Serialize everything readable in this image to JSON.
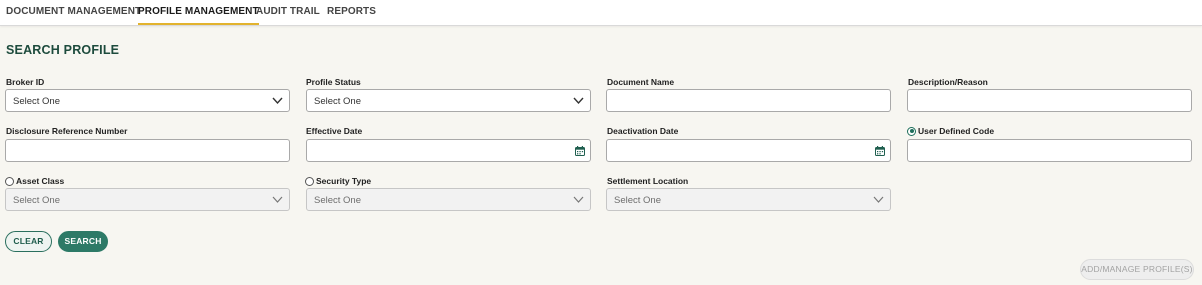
{
  "nav": {
    "tabs": [
      {
        "label": "DOCUMENT MANAGEMENT",
        "active": false
      },
      {
        "label": "PROFILE MANAGEMENT",
        "active": true
      },
      {
        "label": "AUDIT TRAIL",
        "active": false
      },
      {
        "label": "REPORTS",
        "active": false
      }
    ]
  },
  "page": {
    "title": "SEARCH PROFILE"
  },
  "form": {
    "broker_id": {
      "label": "Broker ID",
      "value": "Select One"
    },
    "profile_status": {
      "label": "Profile Status",
      "value": "Select One"
    },
    "document_name": {
      "label": "Document Name",
      "value": ""
    },
    "description_reason": {
      "label": "Description/Reason",
      "value": ""
    },
    "disclosure_reference_number": {
      "label": "Disclosure Reference Number",
      "value": ""
    },
    "effective_date": {
      "label": "Effective Date",
      "value": ""
    },
    "deactivation_date": {
      "label": "Deactivation Date",
      "value": ""
    },
    "user_defined_code": {
      "label": "User Defined Code",
      "value": "",
      "radio_selected": true
    },
    "asset_class": {
      "label": "Asset Class",
      "value": "Select One",
      "radio_selected": false,
      "disabled": true
    },
    "security_type": {
      "label": "Security Type",
      "value": "Select One",
      "radio_selected": false,
      "disabled": true
    },
    "settlement_location": {
      "label": "Settlement Location",
      "value": "Select One",
      "disabled": true
    }
  },
  "buttons": {
    "clear": "CLEAR",
    "search": "SEARCH",
    "add_manage": "ADD/MANAGE PROFILE(S)"
  },
  "icons": {
    "dropdown": "chevron-down-icon",
    "date": "calendar-icon"
  },
  "colors": {
    "accent": "#2d7a67",
    "title": "#1d4b3d",
    "active_tab_underline": "#e2b32e",
    "background": "#f7f6f1"
  }
}
